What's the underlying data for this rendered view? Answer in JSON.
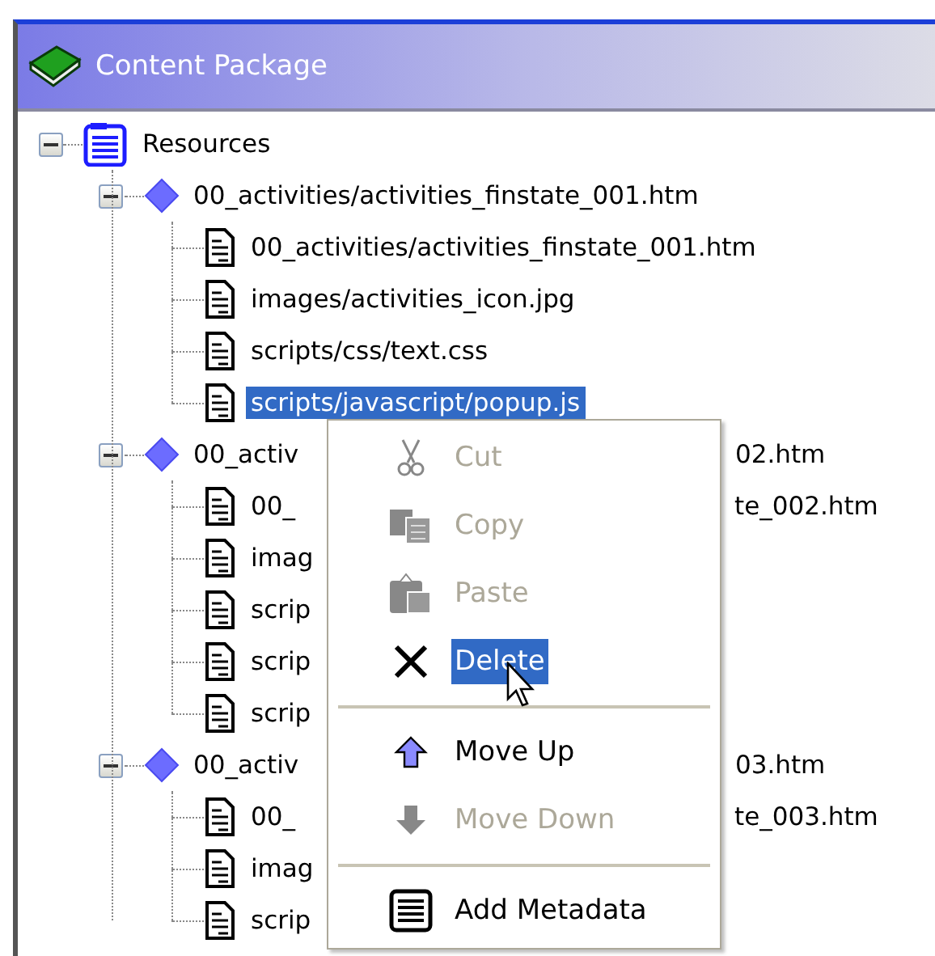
{
  "panel": {
    "title": "Content Package"
  },
  "tree": [
    {
      "kind": "folder",
      "label": "Resources",
      "expanded": true,
      "selected": false,
      "children": [
        {
          "kind": "resource",
          "label": "00_activities/activities_finstate_001.htm",
          "expanded": true,
          "selected": false,
          "children": [
            {
              "kind": "file",
              "label": "00_activities/activities_finstate_001.htm",
              "selected": false
            },
            {
              "kind": "file",
              "label": "images/activities_icon.jpg",
              "selected": false
            },
            {
              "kind": "file",
              "label": "scripts/css/text.css",
              "selected": false
            },
            {
              "kind": "file",
              "label": "scripts/javascript/popup.js",
              "selected": true
            }
          ]
        },
        {
          "kind": "resource",
          "label": "00_activ",
          "label_end": "02.htm",
          "expanded": true,
          "selected": false,
          "children": [
            {
              "kind": "file",
              "label": "00_",
              "label_end": "te_002.htm",
              "selected": false
            },
            {
              "kind": "file",
              "label": "imag",
              "selected": false
            },
            {
              "kind": "file",
              "label": "scrip",
              "selected": false
            },
            {
              "kind": "file",
              "label": "scrip",
              "selected": false
            },
            {
              "kind": "file",
              "label": "scrip",
              "selected": false
            }
          ]
        },
        {
          "kind": "resource",
          "label": "00_activ",
          "label_end": "03.htm",
          "expanded": true,
          "selected": false,
          "children": [
            {
              "kind": "file",
              "label": "00_",
              "label_end": "te_003.htm",
              "selected": false
            },
            {
              "kind": "file",
              "label": "imag",
              "selected": false
            },
            {
              "kind": "file",
              "label": "scrip",
              "selected": false
            }
          ]
        }
      ]
    }
  ],
  "context_menu": [
    {
      "kind": "item",
      "label": "Cut",
      "disabled": true,
      "hovered": false
    },
    {
      "kind": "item",
      "label": "Copy",
      "disabled": true,
      "hovered": false
    },
    {
      "kind": "item",
      "label": "Paste",
      "disabled": true,
      "hovered": false
    },
    {
      "kind": "item",
      "label": "Delete",
      "disabled": false,
      "hovered": true
    },
    {
      "kind": "separator"
    },
    {
      "kind": "item",
      "label": "Move Up",
      "disabled": false,
      "hovered": false
    },
    {
      "kind": "item",
      "label": "Move Down",
      "disabled": true,
      "hovered": false
    },
    {
      "kind": "separator"
    },
    {
      "kind": "item",
      "label": "Add Metadata",
      "disabled": false,
      "hovered": false
    }
  ]
}
